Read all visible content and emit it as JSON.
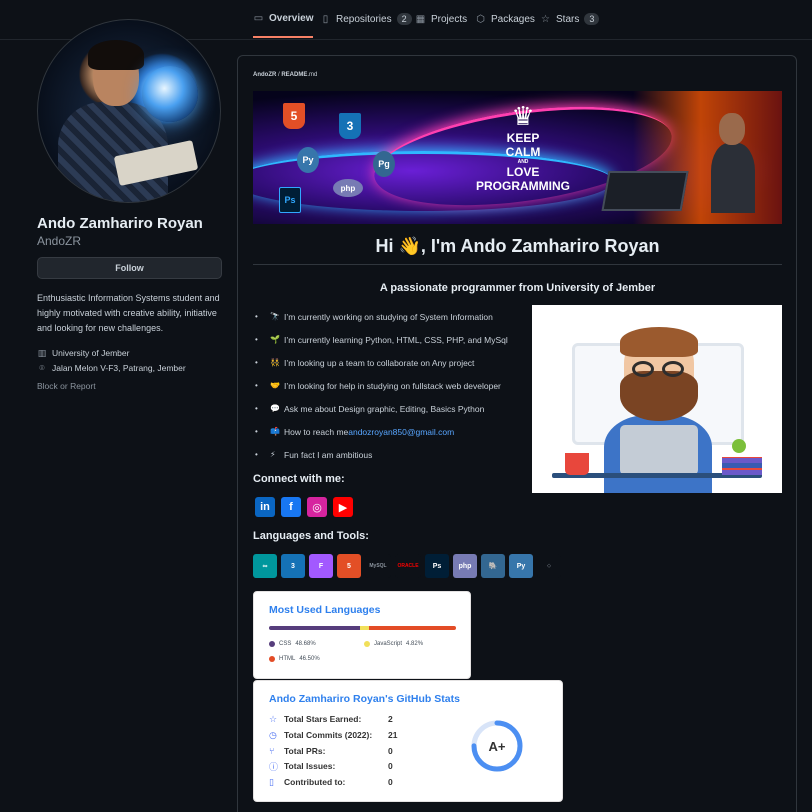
{
  "nav": {
    "tabs": [
      {
        "label": "Overview",
        "icon": "book-icon"
      },
      {
        "label": "Repositories",
        "count": "2",
        "icon": "repo-icon"
      },
      {
        "label": "Projects",
        "icon": "table-icon"
      },
      {
        "label": "Packages",
        "icon": "package-icon"
      },
      {
        "label": "Stars",
        "count": "3",
        "icon": "star-icon"
      }
    ]
  },
  "profile": {
    "name": "Ando Zamhariro Royan",
    "login": "AndoZR",
    "follow_label": "Follow",
    "bio": "Enthusiastic Information Systems student and highly motivated with creative ability, initiative and looking for new challenges.",
    "organization": "University of Jember",
    "location": "Jalan Melon V-F3, Patrang, Jember",
    "block_label": "Block or Report"
  },
  "readme": {
    "breadcrumb_user": "AndoZR",
    "breadcrumb_sep": " / ",
    "breadcrumb_file": "README",
    "breadcrumb_ext": ".md",
    "banner": {
      "l1": "KEEP",
      "l2": "CALM",
      "l3": "AND",
      "l4": "LOVE",
      "l5": "PROGRAMMING"
    },
    "greeting": "Hi 👋, I'm Ando Zamhariro Royan",
    "subtitle": "A passionate programmer from University of Jember",
    "facts": [
      {
        "emoji": "🔭",
        "text": "I’m currently working on studying of System Information"
      },
      {
        "emoji": "🌱",
        "text": "I’m currently learning Python, HTML, CSS, PHP, and MySql"
      },
      {
        "emoji": "👯",
        "text": "I’m looking up a team to collaborate on Any project"
      },
      {
        "emoji": "🤝",
        "text": "I’m looking for help in studying on fullstack web developer"
      },
      {
        "emoji": "💬",
        "text": "Ask me about Design graphic, Editing, Basics Python"
      },
      {
        "emoji": "📫",
        "text": "How to reach me ",
        "link": "andozroyan850@gmail.com"
      },
      {
        "emoji": "⚡",
        "text": "Fun fact I am ambitious"
      }
    ],
    "connect_heading": "Connect with me:",
    "social": [
      {
        "name": "linkedin",
        "glyph": "in",
        "color": "#0a66c2"
      },
      {
        "name": "facebook",
        "glyph": "f",
        "color": "#1877f2"
      },
      {
        "name": "instagram",
        "glyph": "◎",
        "color": "#d6249f"
      },
      {
        "name": "youtube",
        "glyph": "▶",
        "color": "#ff0000"
      }
    ],
    "tools_heading": "Languages and Tools:",
    "tools": [
      {
        "name": "arduino",
        "glyph": "∞",
        "color": "#00979d"
      },
      {
        "name": "css3",
        "glyph": "3",
        "color": "#1572b6"
      },
      {
        "name": "figma",
        "glyph": "F",
        "color": "#a259ff"
      },
      {
        "name": "html5",
        "glyph": "5",
        "color": "#e34f26"
      },
      {
        "name": "mysql",
        "glyph": "MySQL",
        "color": "#0d1117"
      },
      {
        "name": "oracle",
        "glyph": "ORACLE",
        "color": "#0d1117"
      },
      {
        "name": "photoshop",
        "glyph": "Ps",
        "color": "#001e36"
      },
      {
        "name": "php",
        "glyph": "php",
        "color": "#777bb4"
      },
      {
        "name": "postgresql",
        "glyph": "🐘",
        "color": "#336791"
      },
      {
        "name": "python",
        "glyph": "Py",
        "color": "#3776ab"
      },
      {
        "name": "unity",
        "glyph": "◇",
        "color": "#0d1117"
      }
    ],
    "langs": {
      "title": "Most Used Languages",
      "items": [
        {
          "name": "CSS",
          "percent": "48.68%",
          "value": 48.68,
          "color": "#563d7c"
        },
        {
          "name": "JavaScript",
          "percent": "4.82%",
          "value": 4.82,
          "color": "#f1e05a"
        },
        {
          "name": "HTML",
          "percent": "46.50%",
          "value": 46.5,
          "color": "#e34c26"
        }
      ]
    },
    "stats": {
      "title": "Ando Zamhariro Royan's GitHub Stats",
      "rows": [
        {
          "label": "Total Stars Earned:",
          "value": "2",
          "icon": "star-icon"
        },
        {
          "label": "Total Commits (2022):",
          "value": "21",
          "icon": "history-icon"
        },
        {
          "label": "Total PRs:",
          "value": "0",
          "icon": "pull-request-icon"
        },
        {
          "label": "Total Issues:",
          "value": "0",
          "icon": "issue-icon"
        },
        {
          "label": "Contributed to:",
          "value": "0",
          "icon": "repo-icon"
        }
      ],
      "grade": "A+",
      "ring_fill": 0.75
    }
  }
}
